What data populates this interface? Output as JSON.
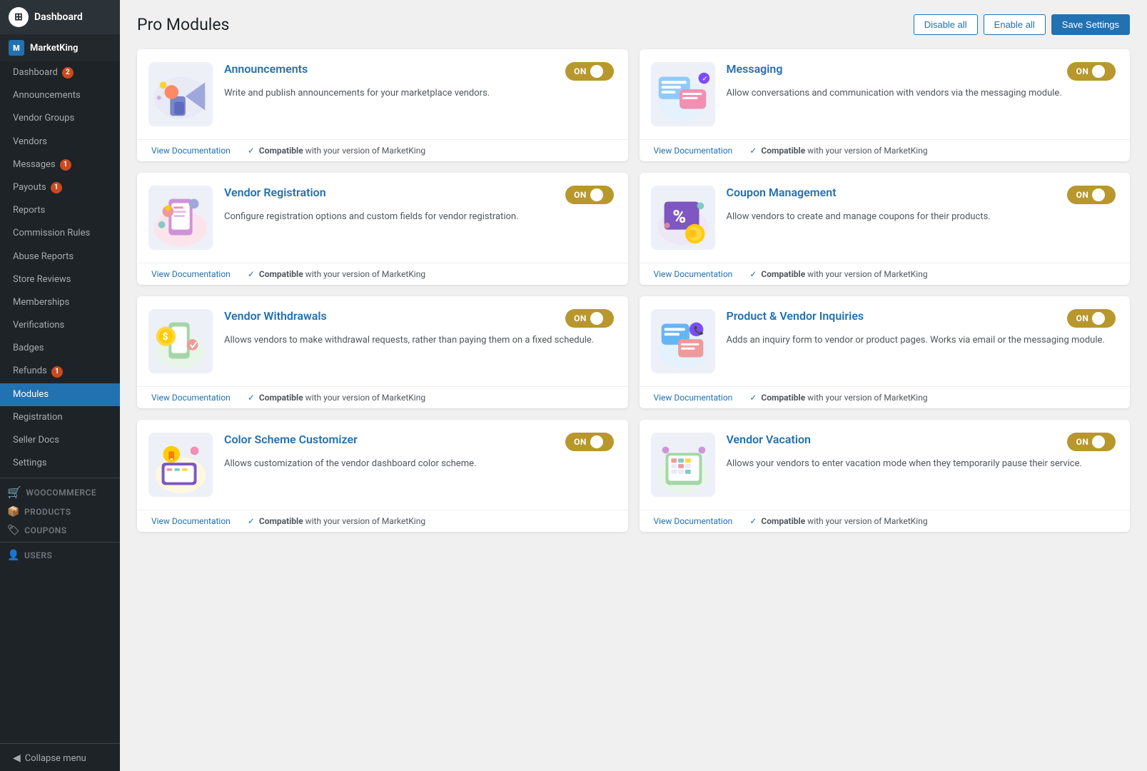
{
  "sidebar": {
    "dashboard_label": "Dashboard",
    "marketking_label": "MarketKing",
    "items": [
      {
        "label": "Dashboard",
        "badge": 2,
        "name": "sidebar-item-dashboard"
      },
      {
        "label": "Announcements",
        "badge": null,
        "name": "sidebar-item-announcements"
      },
      {
        "label": "Vendor Groups",
        "badge": null,
        "name": "sidebar-item-vendor-groups"
      },
      {
        "label": "Vendors",
        "badge": null,
        "name": "sidebar-item-vendors"
      },
      {
        "label": "Messages",
        "badge": 1,
        "name": "sidebar-item-messages"
      },
      {
        "label": "Payouts",
        "badge": 1,
        "name": "sidebar-item-payouts"
      },
      {
        "label": "Reports",
        "badge": null,
        "name": "sidebar-item-reports"
      },
      {
        "label": "Commission Rules",
        "badge": null,
        "name": "sidebar-item-commission-rules"
      },
      {
        "label": "Abuse Reports",
        "badge": null,
        "name": "sidebar-item-abuse-reports"
      },
      {
        "label": "Store Reviews",
        "badge": null,
        "name": "sidebar-item-store-reviews"
      },
      {
        "label": "Memberships",
        "badge": null,
        "name": "sidebar-item-memberships"
      },
      {
        "label": "Verifications",
        "badge": null,
        "name": "sidebar-item-verifications"
      },
      {
        "label": "Badges",
        "badge": null,
        "name": "sidebar-item-badges"
      },
      {
        "label": "Refunds",
        "badge": 1,
        "name": "sidebar-item-refunds"
      },
      {
        "label": "Modules",
        "badge": null,
        "name": "sidebar-item-modules",
        "active": true
      },
      {
        "label": "Registration",
        "badge": null,
        "name": "sidebar-item-registration"
      },
      {
        "label": "Seller Docs",
        "badge": null,
        "name": "sidebar-item-seller-docs"
      },
      {
        "label": "Settings",
        "badge": null,
        "name": "sidebar-item-settings"
      }
    ],
    "woocommerce_label": "WooCommerce",
    "products_label": "Products",
    "coupons_label": "Coupons",
    "users_label": "Users",
    "collapse_label": "Collapse menu"
  },
  "page": {
    "title": "Pro Modules",
    "buttons": {
      "disable_all": "Disable all",
      "enable_all": "Enable all",
      "save_settings": "Save Settings"
    }
  },
  "modules": [
    {
      "id": "announcements",
      "title": "Announcements",
      "description": "Write and publish announcements for your marketplace vendors.",
      "toggle": "ON",
      "doc_link": "View Documentation",
      "compatible": "Compatible with your version of MarketKing"
    },
    {
      "id": "messaging",
      "title": "Messaging",
      "description": "Allow conversations and communication with vendors via the messaging module.",
      "toggle": "ON",
      "doc_link": "View Documentation",
      "compatible": "Compatible with your version of MarketKing"
    },
    {
      "id": "vendor-registration",
      "title": "Vendor Registration",
      "description": "Configure registration options and custom fields for vendor registration.",
      "toggle": "ON",
      "doc_link": "View Documentation",
      "compatible": "Compatible with your version of MarketKing"
    },
    {
      "id": "coupon-management",
      "title": "Coupon Management",
      "description": "Allow vendors to create and manage coupons for their products.",
      "toggle": "ON",
      "doc_link": "View Documentation",
      "compatible": "Compatible with your version of MarketKing"
    },
    {
      "id": "vendor-withdrawals",
      "title": "Vendor Withdrawals",
      "description": "Allows vendors to make withdrawal requests, rather than paying them on a fixed schedule.",
      "toggle": "ON",
      "doc_link": "View Documentation",
      "compatible": "Compatible with your version of MarketKing"
    },
    {
      "id": "product-vendor-inquiries",
      "title": "Product & Vendor Inquiries",
      "description": "Adds an inquiry form to vendor or product pages. Works via email or the messaging module.",
      "toggle": "ON",
      "doc_link": "View Documentation",
      "compatible": "Compatible with your version of MarketKing"
    },
    {
      "id": "color-scheme",
      "title": "Color Scheme Customizer",
      "description": "Allows customization of the vendor dashboard color scheme.",
      "toggle": "ON",
      "doc_link": "View Documentation",
      "compatible": "Compatible with your version of MarketKing"
    },
    {
      "id": "vendor-vacation",
      "title": "Vendor Vacation",
      "description": "Allows your vendors to enter vacation mode when they temporarily pause their service.",
      "toggle": "ON",
      "doc_link": "View Documentation",
      "compatible": "Compatible with your version of MarketKing"
    }
  ]
}
